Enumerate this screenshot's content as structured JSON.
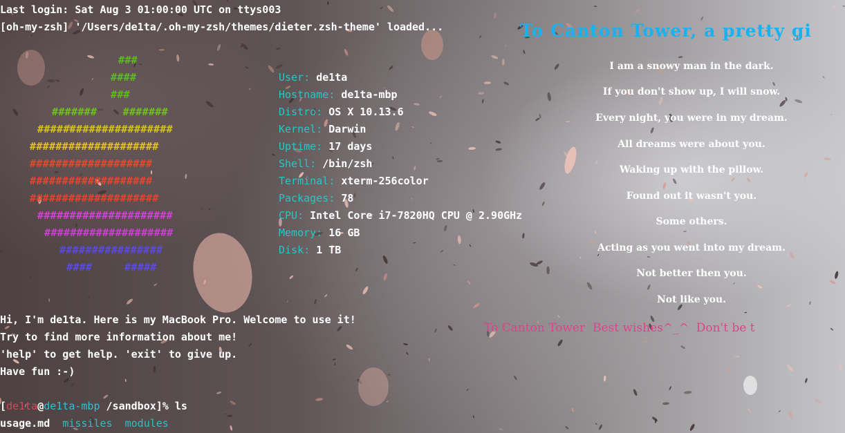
{
  "terminal": {
    "last_login": "Last login: Sat Aug 3 01:00:00 UTC on ttys003",
    "theme_loaded": "[oh-my-zsh] '/Users/de1ta/.oh-my-zsh/themes/dieter.zsh-theme' loaded..."
  },
  "logo": {
    "rows": [
      {
        "text": "###",
        "color": "#5dbb1e"
      },
      {
        "text": "####",
        "color": "#5dbb1e"
      },
      {
        "text": "###",
        "color": "#5dbb1e"
      },
      {
        "text": "#######    #######",
        "color": "#6cc11a"
      },
      {
        "text": "#####################",
        "color": "#d2c319"
      },
      {
        "text": "####################",
        "color": "#e1c21a"
      },
      {
        "text": "###################",
        "color": "#e14a2c"
      },
      {
        "text": "###################",
        "color": "#e4462e"
      },
      {
        "text": "####################",
        "color": "#e3432f"
      },
      {
        "text": "#####################",
        "color": "#d540d2"
      },
      {
        "text": "####################",
        "color": "#cd3ed4"
      },
      {
        "text": "################",
        "color": "#5c4ae0"
      },
      {
        "text": "####     #####",
        "color": "#5a4ae6"
      }
    ]
  },
  "sysinfo": [
    {
      "key": "User: ",
      "value": "de1ta"
    },
    {
      "key": "Hostname: ",
      "value": "de1ta-mbp"
    },
    {
      "key": "Distro: ",
      "value": "OS X 10.13.6"
    },
    {
      "key": "Kernel: ",
      "value": "Darwin"
    },
    {
      "key": "Uptime: ",
      "value": "17 days"
    },
    {
      "key": "Shell: ",
      "value": "/bin/zsh"
    },
    {
      "key": "Terminal: ",
      "value": "xterm-256color"
    },
    {
      "key": "Packages: ",
      "value": "78"
    },
    {
      "key": "CPU: ",
      "value": "Intel Core i7-7820HQ CPU @ 2.90GHz"
    },
    {
      "key": "Memory: ",
      "value": "16 GB"
    },
    {
      "key": "Disk: ",
      "value": "1 TB"
    }
  ],
  "welcome": [
    "Hi, I'm de1ta. Here is my MacBook Pro. Welcome to use it!",
    "Try to find more information about me!",
    "'help' to get help. 'exit' to give up.",
    "Have fun :-)"
  ],
  "prompt": {
    "open": "[",
    "user": "de1ta",
    "at": "@",
    "host": "de1ta-mbp",
    "path": " /sandbox]% ",
    "command": "ls"
  },
  "ls_output": {
    "file": "usage.md",
    "dirs": [
      "missiles",
      "modules"
    ]
  },
  "poem": {
    "title": "To Canton Tower, a pretty gi",
    "lines": [
      "I am a snowy man in the dark.",
      "If you don't show up, I will snow.",
      "Every night, you were in my dream.",
      "All dreams were about you.",
      "Waking up with the pillow.",
      "Found out it wasn't you.",
      "Some others.",
      "Acting as you went into my dream.",
      "Not better then you.",
      "Not like you."
    ],
    "marquee": "To Canton Tower  Best wishes^_^  Don't be t"
  },
  "colors": {
    "info_key": "#27c6c6",
    "poem_title": "#1ab2ee",
    "marquee": "#e33f8b",
    "prompt_user": "#d9455a",
    "prompt_host": "#2ec0d8"
  }
}
